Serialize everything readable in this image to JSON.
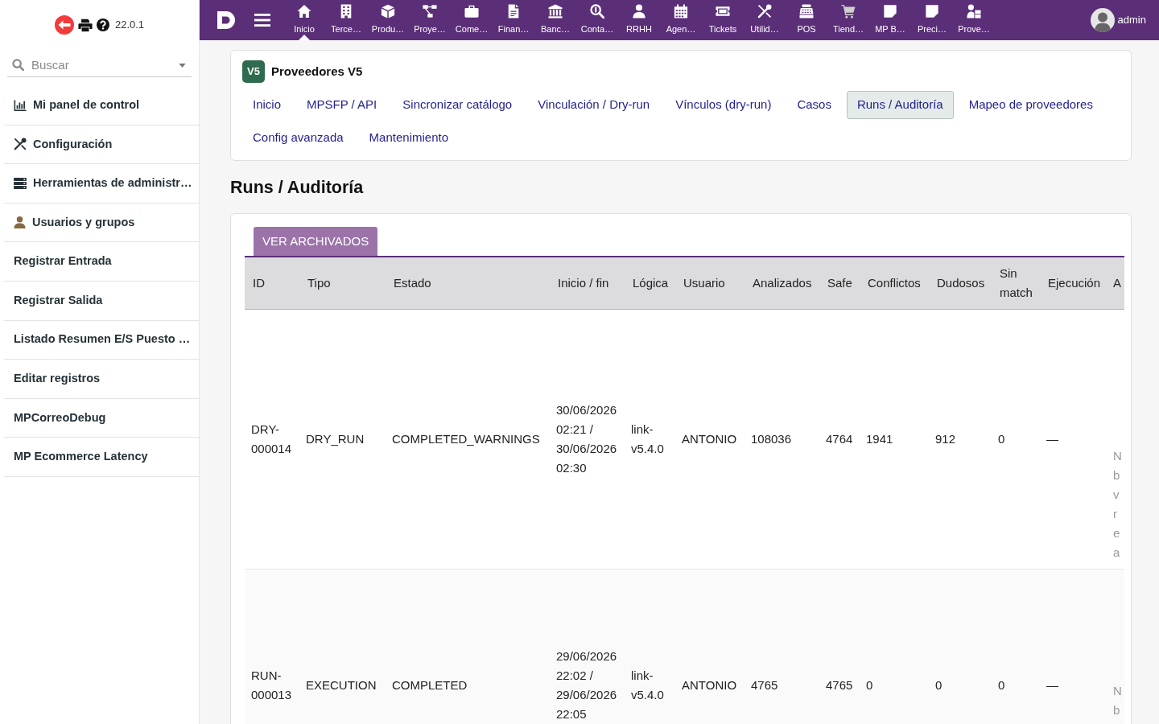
{
  "sidebar": {
    "version": "22.0.1",
    "search": {
      "placeholder": "Buscar"
    },
    "items": [
      {
        "label": "Mi panel de control"
      },
      {
        "label": "Configuración"
      },
      {
        "label": "Herramientas de administr…"
      },
      {
        "label": "Usuarios y grupos"
      },
      {
        "label": "Registrar Entrada"
      },
      {
        "label": "Registrar Salida"
      },
      {
        "label": "Listado Resumen E/S Puesto …"
      },
      {
        "label": "Editar registros"
      },
      {
        "label": "MPCorreoDebug"
      },
      {
        "label": "MP Ecommerce Latency"
      }
    ]
  },
  "top_bar": {
    "nav_items": [
      {
        "label": "Inicio",
        "selected": true
      },
      {
        "label": "Terce…",
        "selected": false
      },
      {
        "label": "Produ…",
        "selected": false
      },
      {
        "label": "Proye…",
        "selected": false
      },
      {
        "label": "Come…",
        "selected": false
      },
      {
        "label": "Finan…",
        "selected": false
      },
      {
        "label": "Banc…",
        "selected": false
      },
      {
        "label": "Conta…",
        "selected": false
      },
      {
        "label": "RRHH",
        "selected": false
      },
      {
        "label": "Agen…",
        "selected": false
      },
      {
        "label": "Tickets",
        "selected": false
      },
      {
        "label": "Utilid…",
        "selected": false
      },
      {
        "label": "POS",
        "selected": false
      },
      {
        "label": "Tiend…",
        "selected": false
      },
      {
        "label": "MP B…",
        "selected": false
      },
      {
        "label": "Preci…",
        "selected": false
      },
      {
        "label": "Prove…",
        "selected": false
      }
    ],
    "user": {
      "name": "admin"
    }
  },
  "module": {
    "badge": "V5",
    "title": "Proveedores V5",
    "tabs": [
      {
        "label": "Inicio",
        "selected": false
      },
      {
        "label": "MPSFP / API",
        "selected": false
      },
      {
        "label": "Sincronizar catálogo",
        "selected": false
      },
      {
        "label": "Vinculación / Dry-run",
        "selected": false
      },
      {
        "label": "Vínculos (dry-run)",
        "selected": false
      },
      {
        "label": "Casos",
        "selected": false
      },
      {
        "label": "Runs / Auditoría",
        "selected": true
      },
      {
        "label": "Mapeo de proveedores",
        "selected": false
      },
      {
        "label": "Config avanzada",
        "selected": false
      },
      {
        "label": "Mantenimiento",
        "selected": false
      }
    ]
  },
  "page_title": "Runs / Auditoría",
  "runs": {
    "archive_button": "VER ARCHIVADOS",
    "table": {
      "columns": [
        "ID",
        "Tipo",
        "Estado",
        "Inicio / fin",
        "Lógica",
        "Usuario",
        "Analizados",
        "Safe",
        "Conflictos",
        "Dudosos",
        "Sin match",
        "Ejecución",
        "A"
      ],
      "rows": [
        [
          "DRY-000014",
          "DRY_RUN",
          "COMPLETED_WARNINGS",
          "30/06/2026 02:21 / 30/06/2026 02:30",
          "link-v5.4.0",
          "ANTONIO",
          "108036",
          "4764",
          "1941",
          "912",
          "0",
          "—",
          "N b v r e a"
        ],
        [
          "RUN-000013",
          "EXECUTION",
          "COMPLETED",
          "29/06/2026 22:02 / 29/06/2026 22:05",
          "link-v5.4.0",
          "ANTONIO",
          "4765",
          "4765",
          "0",
          "0",
          "0",
          "—",
          "N b"
        ]
      ]
    }
  }
}
